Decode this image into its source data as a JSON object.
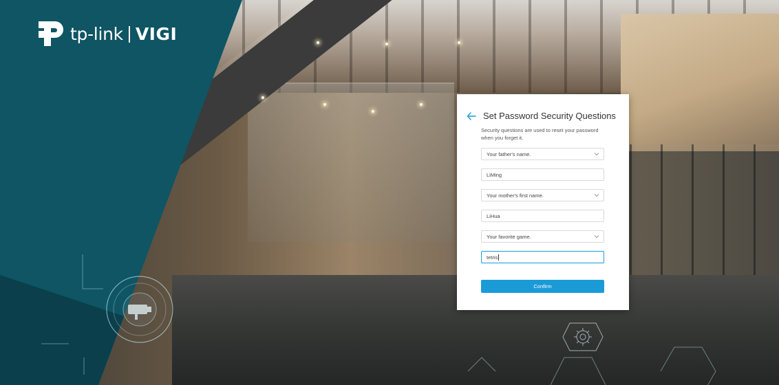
{
  "brand": {
    "name": "tp-link",
    "product": "VIGI"
  },
  "dialog": {
    "title": "Set Password Security Questions",
    "description": "Security questions are used to reset your password when you forget it.",
    "questions": [
      {
        "question": "Your father's name.",
        "answer": "LiMing"
      },
      {
        "question": "Your mother's first name.",
        "answer": "LiHua"
      },
      {
        "question": "Your favorite game.",
        "answer": "tetris"
      }
    ],
    "confirm_label": "Confirm"
  },
  "colors": {
    "brand_teal": "#0f5564",
    "accent_blue": "#1a9bd7"
  },
  "icons": {
    "back": "arrow-left-icon",
    "dropdown": "chevron-down-icon",
    "logo": "tp-link-logo-icon",
    "decor_camera": "camera-icon",
    "decor_gear": "gear-icon"
  }
}
